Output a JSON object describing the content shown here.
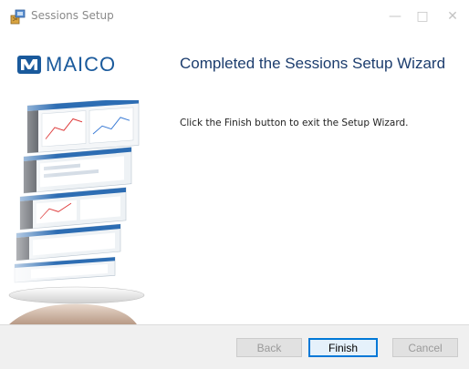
{
  "window": {
    "title": "Sessions Setup",
    "minimize_glyph": "—",
    "maximize_glyph": "□",
    "close_glyph": "✕"
  },
  "brand": {
    "logo_text": "MAICO",
    "logo_color": "#1a5a9c"
  },
  "content": {
    "heading": "Completed the Sessions Setup Wizard",
    "instruction": "Click the Finish button to exit the Setup Wizard."
  },
  "buttons": {
    "back": "Back",
    "finish": "Finish",
    "cancel": "Cancel"
  },
  "colors": {
    "heading": "#1c3d6e",
    "accent": "#0078d7"
  }
}
